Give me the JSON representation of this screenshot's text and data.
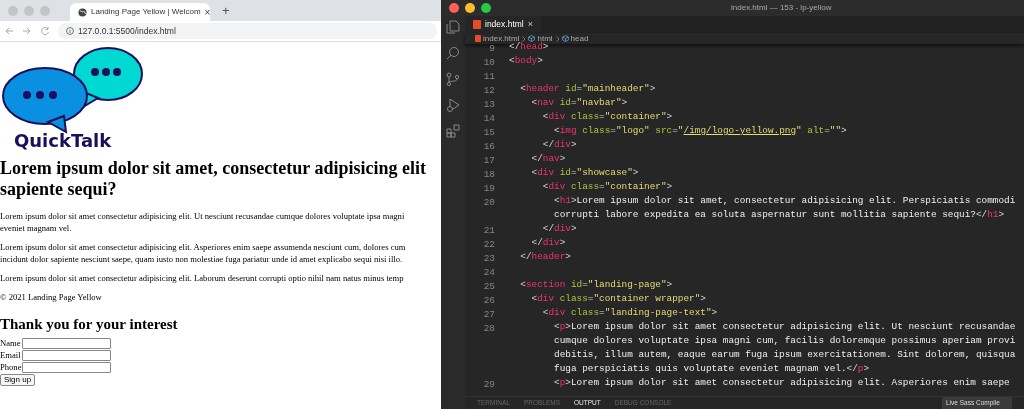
{
  "browser": {
    "tab": {
      "title": "Landing Page Yellow | Welcom",
      "close": "×"
    },
    "new_tab": "+",
    "url": "127.0.0.1:5500/index.html",
    "page": {
      "logo_text": "QuickTalk",
      "heading_lines": [
        "Lorem ipsum dolor sit amet, consectetur adipisicing elit",
        "sapiente sequi?"
      ],
      "paragraphs": [
        [
          "Lorem ipsum dolor sit amet consectetur adipisicing elit. Ut nesciunt recusandae cumque dolores voluptate ipsa magni",
          "eveniet magnam vel."
        ],
        [
          "Lorem ipsum dolor sit amet consectetur adipisicing elit. Asperiores enim saepe assumenda nesciunt cum, dolores cum",
          "incidunt dolor sapiente nesciunt saepe, quam iusto non molestiae fuga pariatur unde id amet explicabo sequi nisi illo."
        ],
        [
          "Lorem ipsum dolor sit amet consectetur adipisicing elit. Laborum deserunt corrupti optio nihil nam natus minus temp"
        ]
      ],
      "footer": "© 2021 Landing Page Yellow",
      "form_title": "Thank you for your interest",
      "fields": [
        {
          "label": "Name"
        },
        {
          "label": "Email"
        },
        {
          "label": "Phone"
        }
      ],
      "submit": "Sign up"
    }
  },
  "editor": {
    "title": "index.html — 153 - lp-yellow",
    "tab": {
      "label": "index.html",
      "close": "×"
    },
    "breadcrumbs": [
      "index.html",
      "html",
      "head"
    ],
    "lines": [
      {
        "number": "9",
        "tokens": [
          {
            "kind": "punct",
            "text": "</"
          },
          {
            "kind": "tag",
            "text": "head"
          },
          {
            "kind": "punct",
            "text": ">"
          }
        ]
      },
      {
        "number": "10",
        "tokens": [
          {
            "kind": "punct",
            "text": "<"
          },
          {
            "kind": "tag",
            "text": "body"
          },
          {
            "kind": "punct",
            "text": ">"
          }
        ]
      },
      {
        "number": "11"
      },
      {
        "number": "12",
        "tokens": [
          {
            "kind": "punct",
            "text": "  <"
          },
          {
            "kind": "tag",
            "text": "header"
          },
          {
            "kind": "attr",
            "text": " id"
          },
          {
            "kind": "punct",
            "text": "="
          },
          {
            "kind": "string",
            "text": "\"mainheader\""
          },
          {
            "kind": "punct",
            "text": ">"
          }
        ]
      },
      {
        "number": "13",
        "tokens": [
          {
            "kind": "punct",
            "text": "    <"
          },
          {
            "kind": "tag",
            "text": "nav"
          },
          {
            "kind": "attr",
            "text": " id"
          },
          {
            "kind": "punct",
            "text": "="
          },
          {
            "kind": "string",
            "text": "\"navbar\""
          },
          {
            "kind": "punct",
            "text": ">"
          }
        ]
      },
      {
        "number": "14",
        "tokens": [
          {
            "kind": "punct",
            "text": "      <"
          },
          {
            "kind": "tag",
            "text": "div"
          },
          {
            "kind": "attr",
            "text": " class"
          },
          {
            "kind": "punct",
            "text": "="
          },
          {
            "kind": "string",
            "text": "\"container\""
          },
          {
            "kind": "punct",
            "text": ">"
          }
        ]
      },
      {
        "number": "15",
        "tokens": [
          {
            "kind": "punct",
            "text": "        <"
          },
          {
            "kind": "tag",
            "text": "img"
          },
          {
            "kind": "attr",
            "text": " class"
          },
          {
            "kind": "punct",
            "text": "="
          },
          {
            "kind": "string",
            "text": "\"logo\""
          },
          {
            "kind": "attr",
            "text": " src"
          },
          {
            "kind": "punct",
            "text": "="
          },
          {
            "kind": "string",
            "text": "\""
          },
          {
            "kind": "link",
            "text": "/img/logo-yellow.png"
          },
          {
            "kind": "string",
            "text": "\""
          },
          {
            "kind": "attr",
            "text": " alt"
          },
          {
            "kind": "punct",
            "text": "="
          },
          {
            "kind": "string",
            "text": "\"\""
          },
          {
            "kind": "punct",
            "text": ">"
          }
        ]
      },
      {
        "number": "16",
        "tokens": [
          {
            "kind": "punct",
            "text": "      </"
          },
          {
            "kind": "tag",
            "text": "div"
          },
          {
            "kind": "punct",
            "text": ">"
          }
        ]
      },
      {
        "number": "17",
        "tokens": [
          {
            "kind": "punct",
            "text": "    </"
          },
          {
            "kind": "tag",
            "text": "nav"
          },
          {
            "kind": "punct",
            "text": ">"
          }
        ]
      },
      {
        "number": "18",
        "tokens": [
          {
            "kind": "punct",
            "text": "    <"
          },
          {
            "kind": "tag",
            "text": "div"
          },
          {
            "kind": "attr",
            "text": " id"
          },
          {
            "kind": "punct",
            "text": "="
          },
          {
            "kind": "string",
            "text": "\"showcase\""
          },
          {
            "kind": "punct",
            "text": ">"
          }
        ]
      },
      {
        "number": "19",
        "tokens": [
          {
            "kind": "punct",
            "text": "      <"
          },
          {
            "kind": "tag",
            "text": "div"
          },
          {
            "kind": "attr",
            "text": " class"
          },
          {
            "kind": "punct",
            "text": "="
          },
          {
            "kind": "string",
            "text": "\"container\""
          },
          {
            "kind": "punct",
            "text": ">"
          }
        ]
      },
      {
        "number": "20",
        "tokens": [
          {
            "kind": "punct",
            "text": "        <"
          },
          {
            "kind": "tag",
            "text": "h1"
          },
          {
            "kind": "punct",
            "text": ">"
          },
          {
            "kind": "text",
            "text": "Lorem ipsum dolor sit amet, consectetur adipisicing elit. Perspiciatis commodi"
          }
        ]
      },
      {
        "tokens": [
          {
            "kind": "text",
            "text": "        corrupti labore expedita ea soluta aspernatur sunt mollitia sapiente sequi?"
          },
          {
            "kind": "punct",
            "text": "</"
          },
          {
            "kind": "tag",
            "text": "h1"
          },
          {
            "kind": "punct",
            "text": ">"
          }
        ]
      },
      {
        "number": "21",
        "tokens": [
          {
            "kind": "punct",
            "text": "      </"
          },
          {
            "kind": "tag",
            "text": "div"
          },
          {
            "kind": "punct",
            "text": ">"
          }
        ]
      },
      {
        "number": "22",
        "tokens": [
          {
            "kind": "punct",
            "text": "    </"
          },
          {
            "kind": "tag",
            "text": "div"
          },
          {
            "kind": "punct",
            "text": ">"
          }
        ]
      },
      {
        "number": "23",
        "tokens": [
          {
            "kind": "punct",
            "text": "  </"
          },
          {
            "kind": "tag",
            "text": "header"
          },
          {
            "kind": "punct",
            "text": ">"
          }
        ]
      },
      {
        "number": "24"
      },
      {
        "number": "25",
        "tokens": [
          {
            "kind": "punct",
            "text": "  <"
          },
          {
            "kind": "tag",
            "text": "section"
          },
          {
            "kind": "attr",
            "text": " id"
          },
          {
            "kind": "punct",
            "text": "="
          },
          {
            "kind": "string",
            "text": "\"landing-page\""
          },
          {
            "kind": "punct",
            "text": ">"
          }
        ]
      },
      {
        "number": "26",
        "tokens": [
          {
            "kind": "punct",
            "text": "    <"
          },
          {
            "kind": "tag",
            "text": "div"
          },
          {
            "kind": "attr",
            "text": " class"
          },
          {
            "kind": "punct",
            "text": "="
          },
          {
            "kind": "string",
            "text": "\"container wrapper\""
          },
          {
            "kind": "punct",
            "text": ">"
          }
        ]
      },
      {
        "number": "27",
        "tokens": [
          {
            "kind": "punct",
            "text": "      <"
          },
          {
            "kind": "tag",
            "text": "div"
          },
          {
            "kind": "attr",
            "text": " class"
          },
          {
            "kind": "punct",
            "text": "="
          },
          {
            "kind": "string",
            "text": "\"landing-page-text\""
          },
          {
            "kind": "punct",
            "text": ">"
          }
        ]
      },
      {
        "number": "28",
        "tokens": [
          {
            "kind": "punct",
            "text": "        <"
          },
          {
            "kind": "tag",
            "text": "p"
          },
          {
            "kind": "punct",
            "text": ">"
          },
          {
            "kind": "text",
            "text": "Lorem ipsum dolor sit amet consectetur adipisicing elit. Ut nesciunt recusandae"
          }
        ]
      },
      {
        "tokens": [
          {
            "kind": "text",
            "text": "        cumque dolores voluptate ipsa magni cum, facilis doloremque possimus aperiam provi"
          }
        ]
      },
      {
        "tokens": [
          {
            "kind": "text",
            "text": "        debitis, illum autem, eaque earum fuga ipsum exercitationem. Sint dolorem, quisqua"
          }
        ]
      },
      {
        "tokens": [
          {
            "kind": "text",
            "text": "        fuga perspiciatis quis voluptate eveniet magnam vel."
          },
          {
            "kind": "punct",
            "text": "</"
          },
          {
            "kind": "tag",
            "text": "p"
          },
          {
            "kind": "punct",
            "text": ">"
          }
        ]
      },
      {
        "number": "29",
        "tokens": [
          {
            "kind": "punct",
            "text": "        <"
          },
          {
            "kind": "tag",
            "text": "p"
          },
          {
            "kind": "punct",
            "text": ">"
          },
          {
            "kind": "text",
            "text": "Lorem ipsum dolor sit amet consectetur adipisicing elit. Asperiores enim saepe"
          }
        ]
      }
    ],
    "panel_tabs": [
      {
        "label": "TERMINAL",
        "selected": false
      },
      {
        "label": "PROBLEMS",
        "selected": false
      },
      {
        "label": "OUTPUT",
        "selected": true
      },
      {
        "label": "DEBUG CONSOLE",
        "selected": false
      }
    ],
    "output_channel": "Live Sass Compile"
  }
}
